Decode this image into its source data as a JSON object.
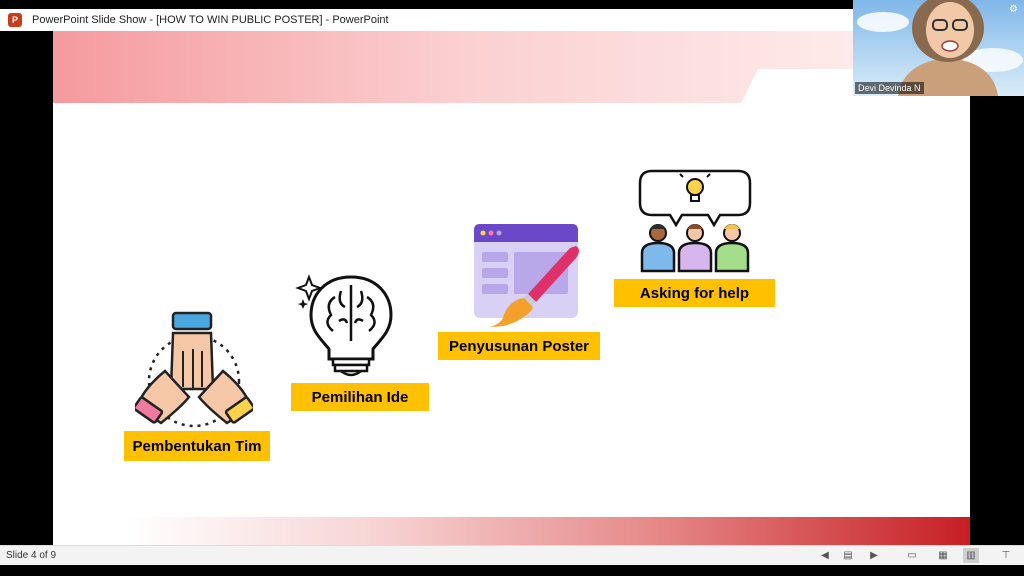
{
  "window": {
    "title": "PowerPoint Slide Show - [HOW TO WIN PUBLIC POSTER] - PowerPoint",
    "app_icon": "powerpoint-icon",
    "app_icon_letter": "P"
  },
  "slide": {
    "labels": {
      "team": "Pembentukan Tim",
      "idea": "Pemilihan Ide",
      "poster": "Penyusunan Poster",
      "help": "Asking for help"
    },
    "icons": {
      "team": "hands-teamwork-icon",
      "idea": "brain-lightbulb-icon",
      "poster": "paint-brush-window-icon",
      "help": "people-discussion-icon"
    },
    "colors": {
      "label_bg": "#ffc000",
      "accent_red": "#c71f24"
    }
  },
  "webcam": {
    "name": "Devi Devinda N"
  },
  "statusbar": {
    "slide_counter": "Slide 4 of 9"
  }
}
